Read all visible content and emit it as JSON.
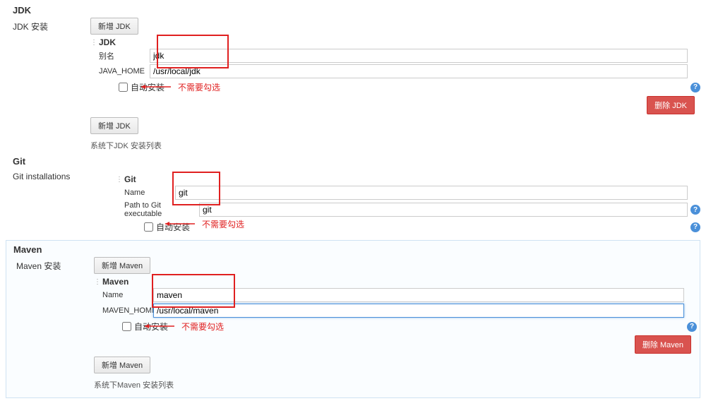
{
  "jdk": {
    "sectionTitle": "JDK",
    "leftLabel": "JDK 安装",
    "addButton": "新增 JDK",
    "toolName": "JDK",
    "aliasLabel": "别名",
    "aliasValue": "jdk",
    "homeLabel": "JAVA_HOME",
    "homeValue": "/usr/local/jdk",
    "autoInstall": "自动安装",
    "deleteButton": "删除 JDK",
    "addButton2": "新增 JDK",
    "listText": "系统下JDK 安装列表",
    "annotation": "不需要勾选"
  },
  "git": {
    "sectionTitle": "Git",
    "leftLabel": "Git installations",
    "toolName": "Git",
    "nameLabel": "Name",
    "nameValue": "git",
    "pathLabel": "Path to Git executable",
    "pathValue": "git",
    "autoInstall": "自动安装",
    "annotation": "不需要勾选"
  },
  "maven": {
    "sectionTitle": "Maven",
    "leftLabel": "Maven 安装",
    "addButton": "新增 Maven",
    "toolName": "Maven",
    "nameLabel": "Name",
    "nameValue": "maven",
    "homeLabel": "MAVEN_HOME",
    "homeValue": "/usr/local/maven",
    "autoInstall": "自动安装",
    "deleteButton": "删除 Maven",
    "addButton2": "新增 Maven",
    "listText": "系统下Maven 安装列表",
    "annotation": "不需要勾选"
  },
  "helpGlyph": "?"
}
